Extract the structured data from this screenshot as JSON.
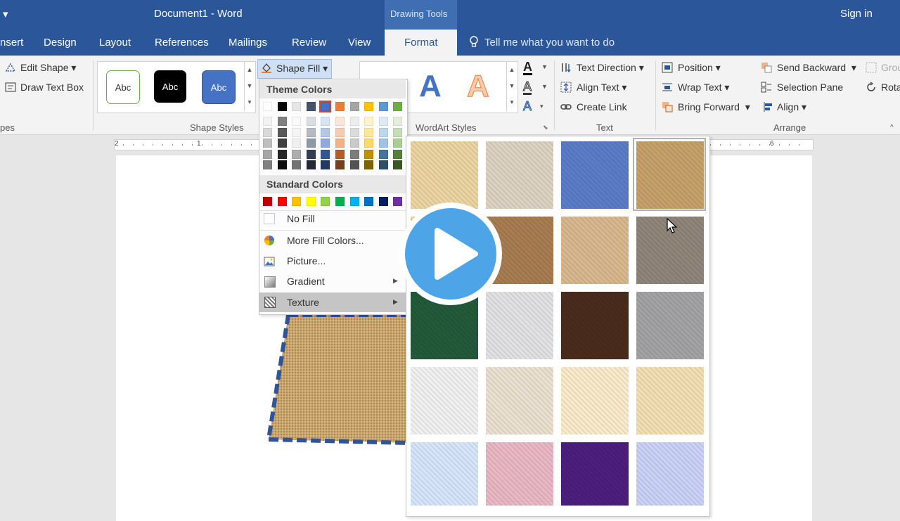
{
  "title_bar": {
    "quick_access": "▾",
    "document_title": "Document1  -  Word",
    "context_group": "Drawing Tools",
    "sign_in": "Sign in"
  },
  "tabs": [
    {
      "label": "nsert"
    },
    {
      "label": "Design"
    },
    {
      "label": "Layout"
    },
    {
      "label": "References"
    },
    {
      "label": "Mailings"
    },
    {
      "label": "Review"
    },
    {
      "label": "View"
    },
    {
      "label": "Format"
    }
  ],
  "tell_me": "Tell me what you want to do",
  "ribbon": {
    "insert_shapes": {
      "edit_shape": "Edit Shape",
      "draw_text_box": "Draw Text Box",
      "label": "pes"
    },
    "shape_styles": {
      "label": "Shape Styles",
      "style_text": "Abc",
      "shape_fill": "Shape Fill"
    },
    "wordart": {
      "label": "WordArt Styles",
      "letter": "A"
    },
    "text": {
      "label": "Text",
      "text_direction": "Text Direction",
      "align_text": "Align Text",
      "create_link": "Create Link"
    },
    "arrange": {
      "label": "Arrange",
      "position": "Position",
      "wrap_text": "Wrap Text",
      "bring_forward": "Bring Forward",
      "send_backward": "Send Backward",
      "selection_pane": "Selection Pane",
      "align": "Align",
      "group": "Grou",
      "rotate": "Rota"
    }
  },
  "ruler": {
    "marks": [
      "2",
      "1",
      "6"
    ]
  },
  "fill_menu": {
    "theme_header": "Theme Colors",
    "standard_header": "Standard Colors",
    "theme_colors": [
      "#ffffff",
      "#000000",
      "#e7e6e6",
      "#44546a",
      "#4472c4",
      "#ed7d31",
      "#a5a5a5",
      "#ffc000",
      "#5b9bd5",
      "#70ad47"
    ],
    "standard_colors": [
      "#c00000",
      "#ff0000",
      "#ffc000",
      "#ffff00",
      "#92d050",
      "#00b050",
      "#00b0f0",
      "#0070c0",
      "#002060",
      "#7030a0"
    ],
    "no_fill": "No Fill",
    "more_colors": "More Fill Colors...",
    "picture": "Picture...",
    "gradient": "Gradient",
    "texture": "Texture"
  },
  "textures": [
    "#ecd4a3",
    "#ddd3c0",
    "#5b7dc8",
    "#c6a26a",
    "#e9d2a6",
    "#a87d52",
    "#d8b88e",
    "#8f8579",
    "#235a3a",
    "#e2e2e4",
    "#4a2c1c",
    "#a3a3a6",
    "#f1f1f1",
    "#ebe1d1",
    "#f9ebcb",
    "#f3dfb4",
    "#d6e5fa",
    "#e9b8c4",
    "#4c1e7d",
    "#c9d2f7"
  ]
}
